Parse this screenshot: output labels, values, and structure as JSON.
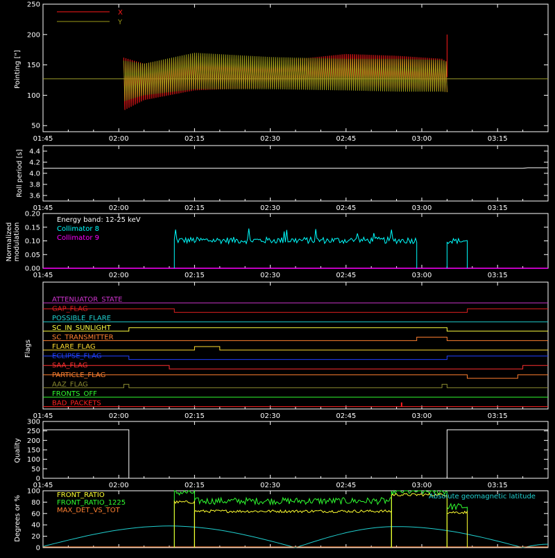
{
  "time_axis": {
    "ticks": [
      "01:45",
      "02:00",
      "02:15",
      "02:30",
      "02:45",
      "03:00",
      "03:15"
    ]
  },
  "chart_data": [
    {
      "type": "line",
      "panel": "pointing",
      "ylabel": "Pointing [\"]",
      "ylim": [
        40,
        250
      ],
      "yticks": [
        50,
        100,
        150,
        200,
        250
      ],
      "xlim": [
        "01:45",
        "03:25"
      ],
      "reference_line": {
        "y": 127,
        "color": "#9a9a2a"
      },
      "series": [
        {
          "name": "X",
          "color": "#ff1a1a",
          "envelope": {
            "x": [
              "02:01",
              "02:05",
              "02:15",
              "02:30",
              "02:45",
              "02:55",
              "03:04",
              "03:05"
            ],
            "upper": [
              162,
              152,
              165,
              155,
              168,
              165,
              160,
              155
            ],
            "lower": [
              75,
              92,
              108,
              113,
              115,
              110,
              107,
              105
            ]
          }
        },
        {
          "name": "Y",
          "color": "#9c9a18",
          "envelope": {
            "x": [
              "02:01",
              "02:05",
              "02:15",
              "02:30",
              "02:45",
              "02:55",
              "03:04",
              "03:05"
            ],
            "upper": [
              157,
              152,
              170,
              163,
              160,
              160,
              158,
              155
            ],
            "lower": [
              90,
              100,
              110,
              110,
              108,
              106,
              106,
              105
            ]
          }
        }
      ]
    },
    {
      "type": "line",
      "panel": "roll-period",
      "ylabel": "Roll period [s]",
      "ylim": [
        3.5,
        4.5
      ],
      "yticks": [
        3.6,
        3.8,
        4.0,
        4.2,
        4.4
      ],
      "series": [
        {
          "color": "#ffffff",
          "x": [
            "01:45",
            "03:20",
            "03:21",
            "03:25"
          ],
          "values": [
            4.09,
            4.09,
            4.1,
            4.1
          ]
        }
      ]
    },
    {
      "type": "line",
      "panel": "modulation",
      "ylabel": "Normalized modulation",
      "ylim": [
        0.0,
        0.2
      ],
      "yticks": [
        0.0,
        0.05,
        0.1,
        0.15,
        0.2
      ],
      "annotation": "Energy band: 12-25 keV",
      "series": [
        {
          "name": "Collimator 8",
          "color": "#00ffff",
          "segments": [
            {
              "start": "02:11",
              "end": "02:59",
              "mean": 0.102,
              "spread": 0.012
            },
            {
              "start": "03:05",
              "end": "03:09",
              "mean": 0.1,
              "spread": 0.01
            }
          ]
        },
        {
          "name": "Collimator 9",
          "color": "#ff00ff",
          "x": [
            "01:45",
            "03:25"
          ],
          "values": [
            0,
            0
          ]
        }
      ]
    },
    {
      "type": "line",
      "panel": "flags",
      "ylabel": "Flags",
      "flags": [
        {
          "name": "ATTENUATOR_STATE",
          "color": "#cc33cc",
          "steps": [
            [
              "01:45",
              0
            ]
          ]
        },
        {
          "name": "SAA_FLAG_GAP",
          "label": "GAP_FLAG",
          "color": "#e02020",
          "steps": [
            [
              "01:45",
              1
            ],
            [
              "02:11",
              0
            ],
            [
              "03:09",
              1
            ]
          ]
        },
        {
          "name": "POSSIBLE_FLARE",
          "color": "#20d0d0",
          "steps": [
            [
              "01:45",
              0
            ]
          ]
        },
        {
          "name": "SC_IN_SUNLIGHT",
          "color": "#ffff40",
          "steps": [
            [
              "01:45",
              0
            ],
            [
              "02:02",
              1
            ],
            [
              "03:05",
              0
            ]
          ]
        },
        {
          "name": "SC_TRANSMITTER",
          "color": "#ff8030",
          "steps": [
            [
              "01:45",
              0
            ],
            [
              "02:59",
              1
            ],
            [
              "03:05",
              0
            ]
          ]
        },
        {
          "name": "FLARE_FLAG",
          "color": "#ffdd30",
          "steps": [
            [
              "01:45",
              0
            ],
            [
              "02:15",
              1
            ],
            [
              "02:20",
              0
            ]
          ]
        },
        {
          "name": "ECLIPSE_FLAG",
          "color": "#2040ff",
          "steps": [
            [
              "01:45",
              1
            ],
            [
              "02:02",
              0
            ],
            [
              "03:05",
              1
            ]
          ]
        },
        {
          "name": "SAA_FLAG",
          "color": "#ff3030",
          "steps": [
            [
              "01:45",
              1
            ],
            [
              "02:10",
              0
            ],
            [
              "03:20",
              1
            ]
          ]
        },
        {
          "name": "PARTICLE_FLAG",
          "color": "#ff8030",
          "steps": [
            [
              "01:45",
              1
            ],
            [
              "03:09",
              0
            ],
            [
              "03:19",
              1
            ]
          ]
        },
        {
          "name": "AAZ_FLAG",
          "color": "#8a8a30",
          "steps": [
            [
              "01:45",
              0
            ],
            [
              "02:01",
              1
            ],
            [
              "02:02",
              0
            ],
            [
              "03:04",
              1
            ],
            [
              "03:05",
              0
            ]
          ]
        },
        {
          "name": "FRONTS_OFF",
          "color": "#30ff30",
          "steps": [
            [
              "01:45",
              0
            ]
          ]
        },
        {
          "name": "BAD_PACKETS",
          "color": "#ff2020",
          "steps": [
            [
              "01:45",
              0
            ],
            [
              "02:56",
              1
            ],
            [
              "02:56",
              0
            ]
          ]
        }
      ]
    },
    {
      "type": "line",
      "panel": "quality",
      "ylabel": "Quality",
      "ylim": [
        0,
        300
      ],
      "yticks": [
        0,
        50,
        100,
        150,
        200,
        250,
        300
      ],
      "series": [
        {
          "color": "#ffffff",
          "steps": [
            [
              "01:45",
              256
            ],
            [
              "02:02",
              0
            ],
            [
              "03:05",
              256
            ],
            [
              "03:25",
              256
            ]
          ]
        }
      ]
    },
    {
      "type": "line",
      "panel": "ratios",
      "ylabel": "Degrees or %",
      "ylim": [
        0,
        100
      ],
      "yticks": [
        0,
        20,
        40,
        60,
        80,
        100
      ],
      "annotation": "Absolute geomagnetic latitude",
      "series": [
        {
          "name": "FRONT_RATIO",
          "color": "#ffff30",
          "segments": [
            {
              "start": "02:11",
              "end": "02:15",
              "mean": 80
            },
            {
              "start": "02:15",
              "end": "02:54",
              "mean": 64
            },
            {
              "start": "02:54",
              "end": "03:05",
              "mean": 93
            },
            {
              "start": "03:05",
              "end": "03:09",
              "mean": 62
            }
          ]
        },
        {
          "name": "FRONT_RATIO_1225",
          "color": "#30ff30",
          "segments": [
            {
              "start": "02:11",
              "end": "02:15",
              "mean": 97
            },
            {
              "start": "02:15",
              "end": "02:54",
              "mean": 82
            },
            {
              "start": "02:54",
              "end": "03:05",
              "mean": 99
            },
            {
              "start": "03:05",
              "end": "03:09",
              "mean": 72
            }
          ]
        },
        {
          "name": "MAX_DET_VS_TOT",
          "color": "#ff8030",
          "x": [
            "01:45",
            "03:25"
          ],
          "values": [
            0,
            0
          ]
        },
        {
          "name": "Absolute geomagnetic latitude",
          "color": "#20d0d0",
          "x": [
            "01:45",
            "02:10",
            "02:35",
            "02:55",
            "03:20",
            "03:25"
          ],
          "values": [
            2,
            38,
            0,
            37,
            0,
            6
          ]
        }
      ]
    }
  ],
  "legend_pointing": {
    "x_label": "X",
    "y_label": "Y"
  },
  "legend_mod": {
    "energy": "Energy band: 12-25 keV",
    "c8": "Collimator 8",
    "c9": "Collimator 9"
  },
  "legend_ratio": {
    "a": "FRONT_RATIO",
    "b": "FRONT_RATIO_1225",
    "c": "MAX_DET_VS_TOT",
    "d": "Absolute geomagnetic latitude"
  },
  "ylabels": {
    "pointing": "Pointing [\"]",
    "roll": "Roll period [s]",
    "mod1": "Normalized",
    "mod2": "modulation",
    "flags": "Flags",
    "quality": "Quality",
    "ratio": "Degrees or %"
  },
  "colors": {
    "background": "#000000",
    "axes": "#ffffff"
  }
}
